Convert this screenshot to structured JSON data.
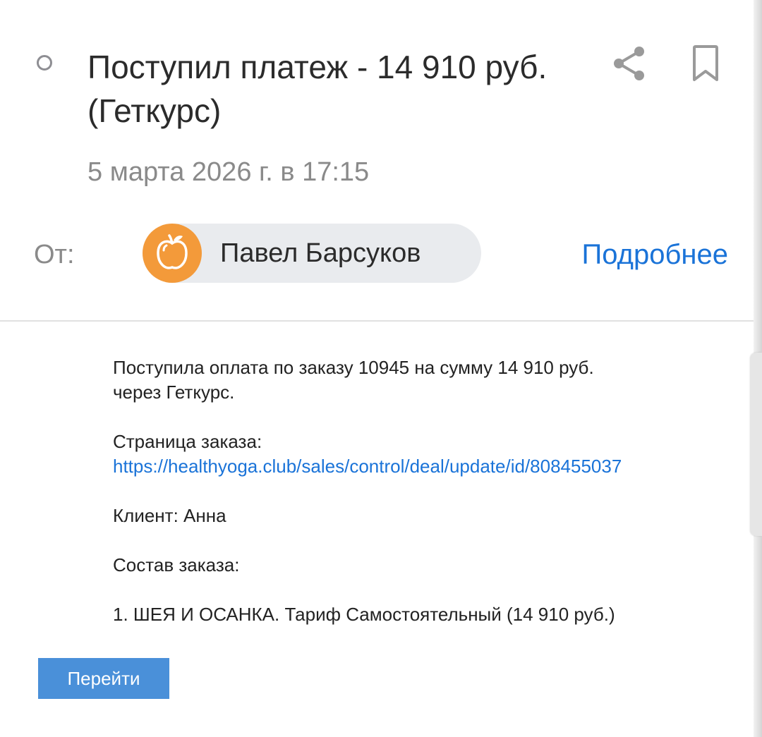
{
  "message": {
    "subject": "Поступил платеж - 14 910 руб. (Геткурс)",
    "date": "5 марта 2026 г. в 17:15"
  },
  "sender": {
    "from_label": "От:",
    "name": "Павел Барсуков",
    "avatar_icon": "apple-icon",
    "avatar_color": "#f39a3a",
    "details_link": "Подробнее"
  },
  "actions": {
    "share_icon": "share-icon",
    "bookmark_icon": "bookmark-icon"
  },
  "body": {
    "payment_line1": "Поступила оплата по заказу 10945 на сумму 14 910 руб.",
    "payment_line2": "через Геткурс.",
    "order_page_label": "Страница заказа:",
    "order_page_url": "https://healthyoga.club/sales/control/deal/update/id/808455037",
    "client": "Клиент: Анна",
    "order_contents_label": "Состав заказа:",
    "order_item": "1. ШЕЯ И ОСАНКА. Тариф Самостоятельный (14 910 руб.)"
  },
  "button": {
    "label": "Перейти",
    "color": "#4a90d9"
  },
  "colors": {
    "link": "#1a73d8",
    "muted_text": "#8a8a8a"
  }
}
